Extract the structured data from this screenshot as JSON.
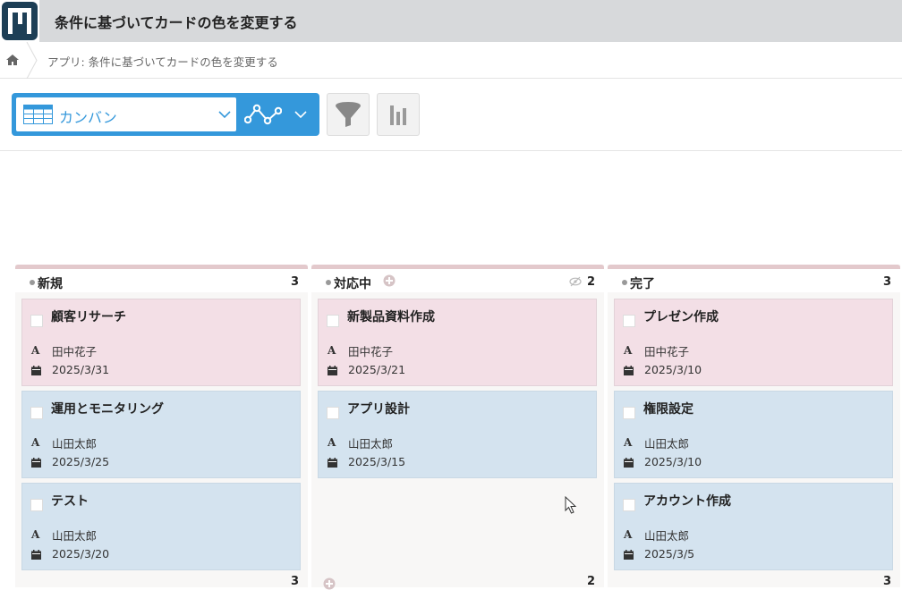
{
  "app": {
    "title": "条件に基づいてカードの色を変更する",
    "breadcrumb": "アプリ: 条件に基づいてカードの色を変更する"
  },
  "toolbar": {
    "view_label": "カンバン",
    "view_icon": "table-icon",
    "graph_icon": "graph-icon",
    "filter_icon": "filter-icon",
    "chart_icon": "bar-chart-icon"
  },
  "colors": {
    "accent": "#3498db",
    "card_pink": "#f3dfe6",
    "card_blue": "#d4e3ef"
  },
  "columns": [
    {
      "title": "新規",
      "count": "3",
      "footer_count": "3",
      "cards": [
        {
          "title": "顧客リサーチ",
          "person": "田中花子",
          "date": "2025/3/31",
          "color": "pink"
        },
        {
          "title": "運用とモニタリング",
          "person": "山田太郎",
          "date": "2025/3/25",
          "color": "blue"
        },
        {
          "title": "テスト",
          "person": "山田太郎",
          "date": "2025/3/20",
          "color": "blue"
        }
      ]
    },
    {
      "title": "対応中",
      "count": "2",
      "footer_count": "2",
      "cards": [
        {
          "title": "新製品資料作成",
          "person": "田中花子",
          "date": "2025/3/21",
          "color": "pink"
        },
        {
          "title": "アプリ設計",
          "person": "山田太郎",
          "date": "2025/3/15",
          "color": "blue"
        }
      ]
    },
    {
      "title": "完了",
      "count": "3",
      "footer_count": "3",
      "cards": [
        {
          "title": "プレゼン作成",
          "person": "田中花子",
          "date": "2025/3/10",
          "color": "pink"
        },
        {
          "title": "権限設定",
          "person": "山田太郎",
          "date": "2025/3/10",
          "color": "blue"
        },
        {
          "title": "アカウント作成",
          "person": "山田太郎",
          "date": "2025/3/5",
          "color": "blue"
        }
      ]
    }
  ]
}
